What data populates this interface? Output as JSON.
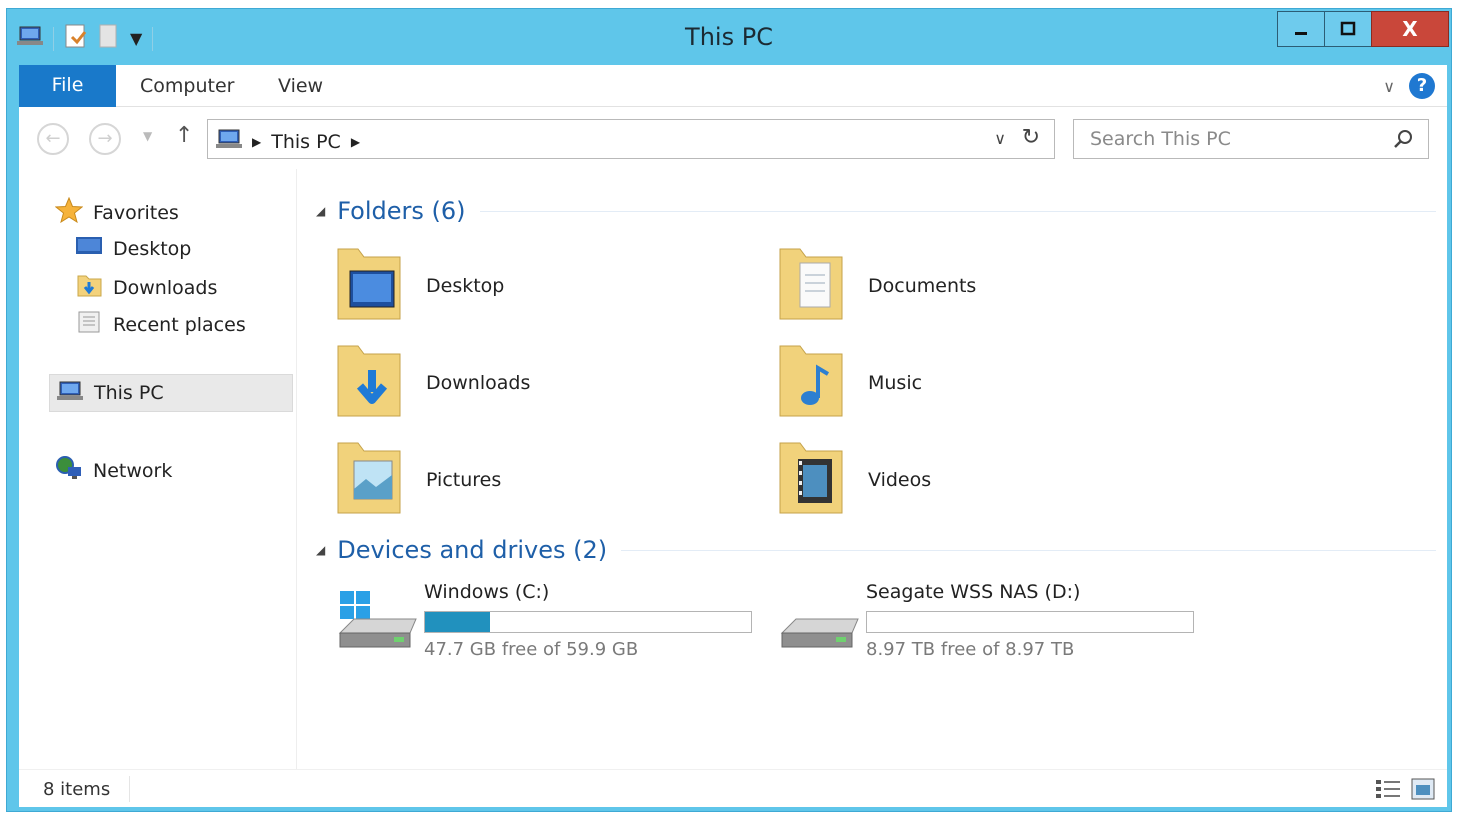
{
  "window": {
    "title": "This PC"
  },
  "ribbon": {
    "tabs": [
      "File",
      "Computer",
      "View"
    ]
  },
  "address": {
    "crumbs": [
      "This PC"
    ],
    "search_placeholder": "Search This PC"
  },
  "navpane": {
    "favorites": "Favorites",
    "desktop": "Desktop",
    "downloads": "Downloads",
    "recent": "Recent places",
    "this_pc": "This PC",
    "network": "Network"
  },
  "groups": {
    "folders_header": "Folders (6)",
    "drives_header": "Devices and drives (2)"
  },
  "folders": [
    "Desktop",
    "Documents",
    "Downloads",
    "Music",
    "Pictures",
    "Videos"
  ],
  "drives": [
    {
      "name": "Windows (C:)",
      "free_text": "47.7 GB free of 59.9 GB",
      "used_fraction": 0.2
    },
    {
      "name": "Seagate WSS NAS (D:)",
      "free_text": "8.97 TB free of 8.97 TB",
      "used_fraction": 0.0
    }
  ],
  "status": {
    "item_count": "8 items"
  },
  "colors": {
    "titlebar": "#5fc6ea",
    "file_tab": "#1979ca",
    "accent_text": "#1e5fa8",
    "close_button": "#c9473a",
    "drive_fill": "#2191be"
  }
}
